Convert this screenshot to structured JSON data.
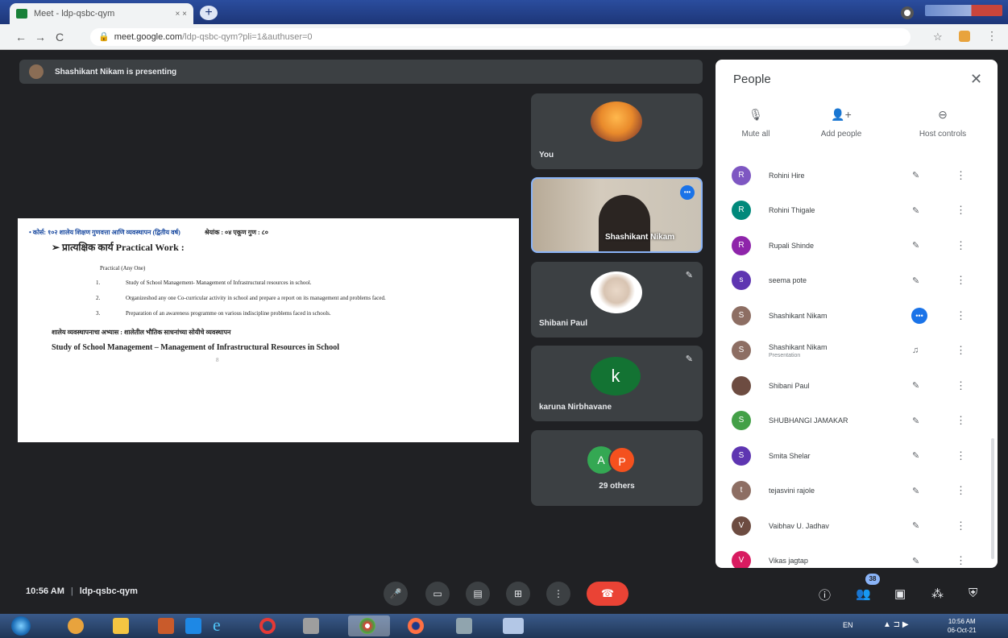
{
  "browser": {
    "tab_title": "Meet - ldp-qsbc-qym",
    "tab_close": "× ×",
    "new_tab": "+",
    "url_host": "meet.google.com",
    "url_path": "/ldp-qsbc-qym?pli=1&authuser=0",
    "nav": {
      "back": "←",
      "forward": "→",
      "reload": "C"
    }
  },
  "meet": {
    "presenting_text": "Shashikant Nikam is presenting",
    "slide": {
      "course_line": "• कोर्स: १०२ शालेय शिक्षण गुणवत्ता आणि व्यवस्थापन (द्वितीय वर्ष)",
      "marks_line": "श्रेयांक : ०४     एकूण गुण : ८०",
      "practical_heading": "➢ प्रात्यक्षिक कार्य  Practical Work :",
      "practical_sub": "Practical        (Any One)",
      "items": [
        "Study of School Management- Management of Infrastructural resources in school.",
        "Organizeshod any one  Co-curricular activity in school and prepare a report on its management  and problems faced.",
        "Preparation of an awareness programme on various indiscipline problems faced in schools."
      ],
      "study_mr": "शालेय व्यवस्थापनाचा अभ्यास : शालेतील भौतिक साधनांच्या सोयीचे व्यवस्थापन",
      "study_en": "Study of School Management – Management of Infrastructural Resources in School",
      "page_no": "8"
    },
    "tiles": {
      "you": "You",
      "speaker": "Shashikant Nikam",
      "shibani": "Shibani Paul",
      "karuna": "karuna Nirbhavane",
      "karuna_initial": "k",
      "others_a": "A",
      "others_p": "P",
      "others_label": "29 others"
    }
  },
  "people_panel": {
    "title": "People",
    "close": "✕",
    "actions": [
      {
        "icon": "mic-off-icon",
        "label": "Mute all"
      },
      {
        "icon": "add-person-icon",
        "label": "Add people"
      },
      {
        "icon": "host-controls-icon",
        "label": "Host controls"
      }
    ],
    "participants": [
      {
        "initial": "R",
        "name": "Rohini Hire",
        "sub": "",
        "color": "#7e57c2",
        "mic": "off"
      },
      {
        "initial": "R",
        "name": "Rohini Thigale",
        "sub": "",
        "color": "#00897b",
        "mic": "off"
      },
      {
        "initial": "R",
        "name": "Rupali Shinde",
        "sub": "",
        "color": "#8e24aa",
        "mic": "off"
      },
      {
        "initial": "s",
        "name": "seema pote",
        "sub": "",
        "color": "#5e35b1",
        "mic": "off"
      },
      {
        "initial": "S",
        "name": "Shashikant Nikam",
        "sub": "",
        "color": "#8d6e63",
        "mic": "active"
      },
      {
        "initial": "S",
        "name": "Shashikant Nikam",
        "sub": "Presentation",
        "color": "#8d6e63",
        "mic": "presenting"
      },
      {
        "initial": "",
        "name": "Shibani Paul",
        "sub": "",
        "color": "#6d4c41",
        "mic": "off"
      },
      {
        "initial": "S",
        "name": "SHUBHANGI JAMAKAR",
        "sub": "",
        "color": "#43a047",
        "mic": "off"
      },
      {
        "initial": "S",
        "name": "Smita Shelar",
        "sub": "",
        "color": "#5e35b1",
        "mic": "off"
      },
      {
        "initial": "t",
        "name": "tejasvini rajole",
        "sub": "",
        "color": "#8d6e63",
        "mic": "off"
      },
      {
        "initial": "V",
        "name": "Vaibhav U. Jadhav",
        "sub": "",
        "color": "#6d4c41",
        "mic": "off"
      },
      {
        "initial": "V",
        "name": "Vikas jagtap",
        "sub": "",
        "color": "#d81b60",
        "mic": "off"
      }
    ]
  },
  "bottom_bar": {
    "time": "10:56 AM",
    "separator": "|",
    "meeting_code": "ldp-qsbc-qym",
    "people_count": "38"
  },
  "taskbar": {
    "lang": "EN",
    "clock_time": "10:56 AM",
    "clock_date": "06-Oct-21"
  }
}
